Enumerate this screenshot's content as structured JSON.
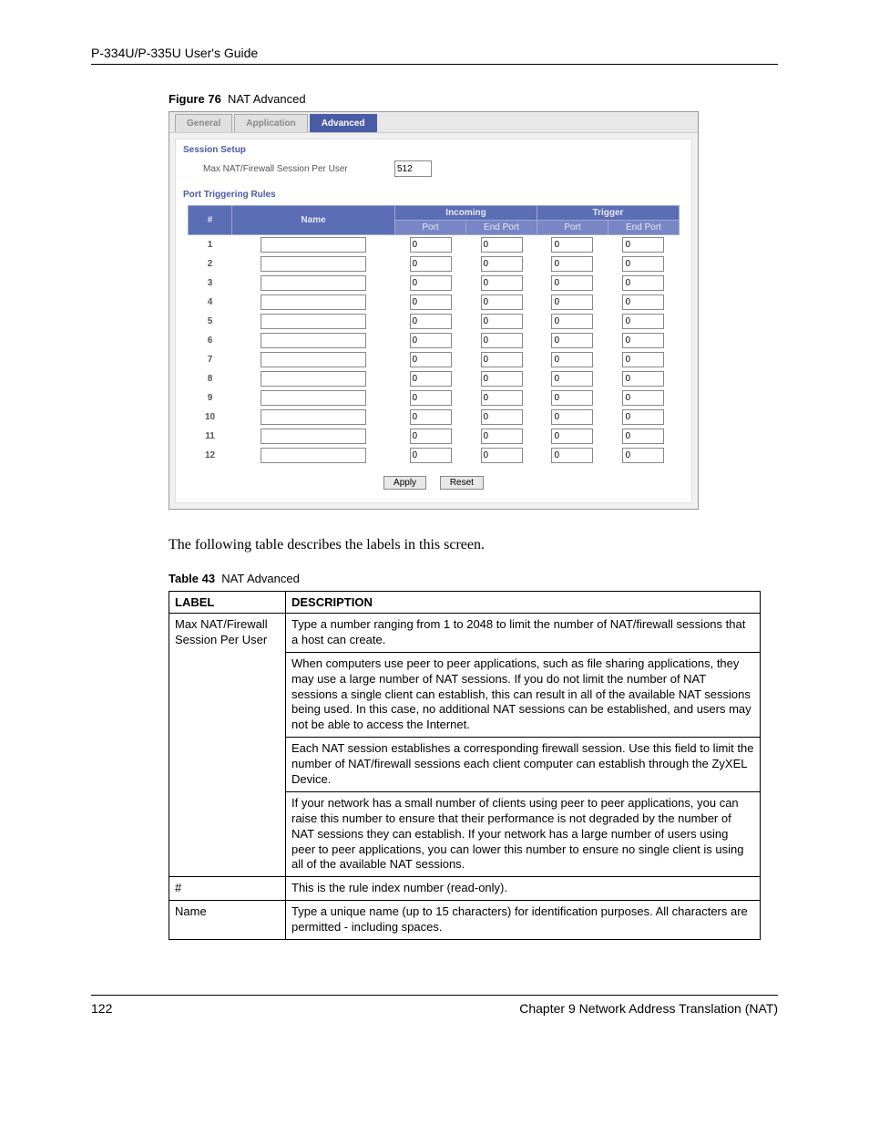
{
  "header": {
    "guide_title": "P-334U/P-335U User's Guide"
  },
  "figure": {
    "label": "Figure 76",
    "title": "NAT Advanced",
    "tabs": [
      "General",
      "Application",
      "Advanced"
    ],
    "active_tab": 2,
    "session_setup_heading": "Session Setup",
    "session_label": "Max NAT/Firewall Session Per User",
    "session_value": "512",
    "port_rules_heading": "Port Triggering Rules",
    "table_headers": {
      "idx": "#",
      "name": "Name",
      "incoming": "Incoming",
      "trigger": "Trigger",
      "port": "Port",
      "end_port": "End Port"
    },
    "rows": [
      {
        "idx": "1",
        "name": "",
        "in_port": "0",
        "in_end": "0",
        "tr_port": "0",
        "tr_end": "0"
      },
      {
        "idx": "2",
        "name": "",
        "in_port": "0",
        "in_end": "0",
        "tr_port": "0",
        "tr_end": "0"
      },
      {
        "idx": "3",
        "name": "",
        "in_port": "0",
        "in_end": "0",
        "tr_port": "0",
        "tr_end": "0"
      },
      {
        "idx": "4",
        "name": "",
        "in_port": "0",
        "in_end": "0",
        "tr_port": "0",
        "tr_end": "0"
      },
      {
        "idx": "5",
        "name": "",
        "in_port": "0",
        "in_end": "0",
        "tr_port": "0",
        "tr_end": "0"
      },
      {
        "idx": "6",
        "name": "",
        "in_port": "0",
        "in_end": "0",
        "tr_port": "0",
        "tr_end": "0"
      },
      {
        "idx": "7",
        "name": "",
        "in_port": "0",
        "in_end": "0",
        "tr_port": "0",
        "tr_end": "0"
      },
      {
        "idx": "8",
        "name": "",
        "in_port": "0",
        "in_end": "0",
        "tr_port": "0",
        "tr_end": "0"
      },
      {
        "idx": "9",
        "name": "",
        "in_port": "0",
        "in_end": "0",
        "tr_port": "0",
        "tr_end": "0"
      },
      {
        "idx": "10",
        "name": "",
        "in_port": "0",
        "in_end": "0",
        "tr_port": "0",
        "tr_end": "0"
      },
      {
        "idx": "11",
        "name": "",
        "in_port": "0",
        "in_end": "0",
        "tr_port": "0",
        "tr_end": "0"
      },
      {
        "idx": "12",
        "name": "",
        "in_port": "0",
        "in_end": "0",
        "tr_port": "0",
        "tr_end": "0"
      }
    ],
    "buttons": {
      "apply": "Apply",
      "reset": "Reset"
    }
  },
  "body_text": "The following table describes the labels in this screen.",
  "table": {
    "label": "Table 43",
    "title": "NAT Advanced",
    "headers": {
      "label": "LABEL",
      "description": "DESCRIPTION"
    },
    "rows": [
      {
        "label": "Max NAT/Firewall Session Per User",
        "descs": [
          "Type a number ranging from 1 to 2048 to limit the number of NAT/firewall sessions that a host can create.",
          "When computers use peer to peer applications, such as file sharing applications, they may use a large number of NAT sessions. If you do not limit the number of NAT sessions a single client can establish, this can result in all of the available NAT sessions being used. In this case, no additional NAT sessions can be established, and users may not be able to access the Internet.",
          "Each NAT session establishes a corresponding firewall session. Use this field to limit the number of NAT/firewall sessions each client computer can establish through the ZyXEL Device.",
          "If your network has a small number of clients using peer to peer applications, you can raise this number to ensure that their performance is not degraded by the number of NAT sessions they can establish. If your network has a large number of users using peer to peer applications, you can lower this number to ensure no single client is using all of the available NAT sessions."
        ]
      },
      {
        "label": "#",
        "descs": [
          "This is the rule index number (read-only)."
        ]
      },
      {
        "label": "Name",
        "descs": [
          "Type a unique name (up to 15 characters) for identification purposes. All characters are permitted - including spaces."
        ]
      }
    ]
  },
  "footer": {
    "page": "122",
    "chapter": "Chapter 9 Network Address Translation (NAT)"
  }
}
